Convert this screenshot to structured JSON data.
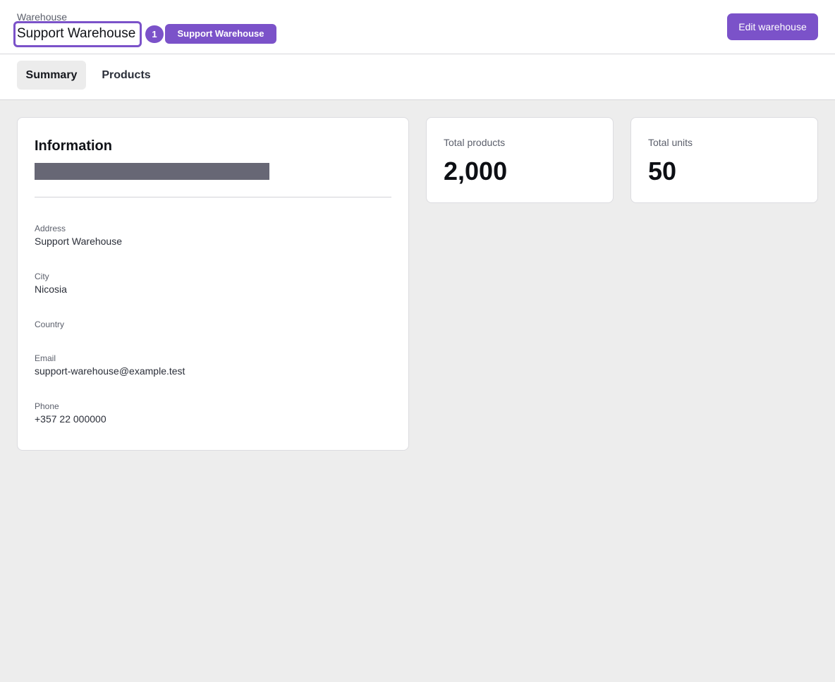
{
  "header": {
    "breadcrumb": "Warehouse",
    "title": "Support Warehouse",
    "badge_number": "1",
    "name_pill": "Support Warehouse",
    "edit_label": "Edit warehouse"
  },
  "tabs": [
    {
      "label": "Summary",
      "active": true
    },
    {
      "label": "Products",
      "active": false
    }
  ],
  "information": {
    "title": "Information",
    "fields": [
      {
        "label": "Address",
        "value": "Support Warehouse"
      },
      {
        "label": "City",
        "value": "Nicosia"
      },
      {
        "label": "Country",
        "value": ""
      },
      {
        "label": "Email",
        "value": "support-warehouse@example.test"
      },
      {
        "label": "Phone",
        "value": "+357 22 000000"
      }
    ]
  },
  "stats": {
    "total_products": {
      "label": "Total products",
      "value": "2,000"
    },
    "total_units": {
      "label": "Total units",
      "value": "50"
    }
  },
  "colors": {
    "accent": "#7b52c9",
    "background": "#ededed",
    "redaction": "#676775"
  }
}
